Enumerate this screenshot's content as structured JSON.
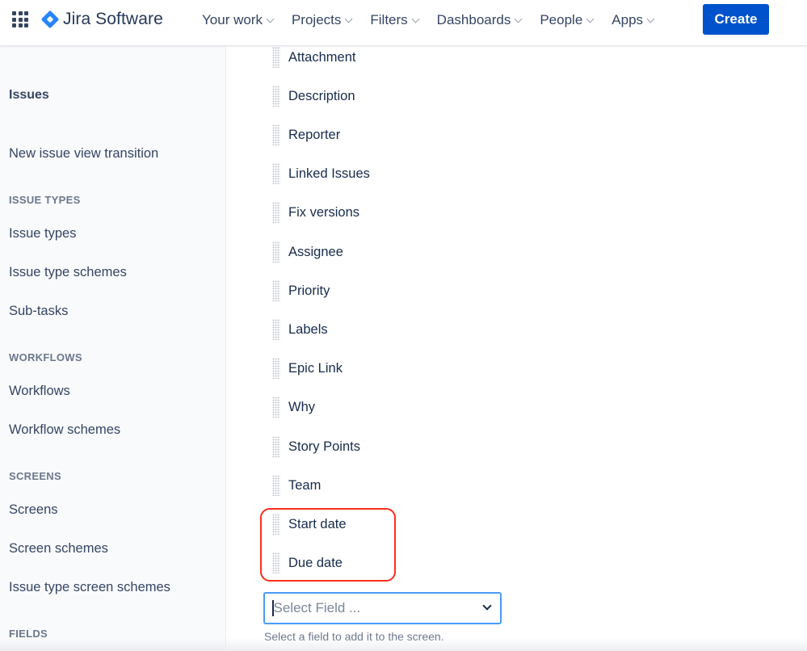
{
  "topbar": {
    "product_name": "Jira Software",
    "nav": [
      {
        "label": "Your work"
      },
      {
        "label": "Projects"
      },
      {
        "label": "Filters"
      },
      {
        "label": "Dashboards"
      },
      {
        "label": "People"
      },
      {
        "label": "Apps"
      }
    ],
    "create_label": "Create",
    "brand_color": "#0052cc"
  },
  "sidebar": {
    "title": "Issues",
    "items": {
      "new_issue_view": "New issue view transition",
      "issue_types_heading": "ISSUE TYPES",
      "issue_types": "Issue types",
      "issue_type_schemes": "Issue type schemes",
      "sub_tasks": "Sub-tasks",
      "workflows_heading": "WORKFLOWS",
      "workflows": "Workflows",
      "workflow_schemes": "Workflow schemes",
      "screens_heading": "SCREENS",
      "screens": "Screens",
      "screen_schemes": "Screen schemes",
      "issue_type_screen_schemes": "Issue type screen schemes",
      "fields_heading": "FIELDS"
    }
  },
  "main": {
    "fields": [
      "Attachment",
      "Description",
      "Reporter",
      "Linked Issues",
      "Fix versions",
      "Assignee",
      "Priority",
      "Labels",
      "Epic Link",
      "Why",
      "Story Points",
      "Team",
      "Start date",
      "Due date"
    ],
    "highlighted_fields": [
      "Start date",
      "Due date"
    ],
    "highlight_color": "#ff2d1a",
    "select_field": {
      "placeholder": "Select Field ...",
      "value": ""
    },
    "help_text": "Select a field to add it to the screen."
  }
}
